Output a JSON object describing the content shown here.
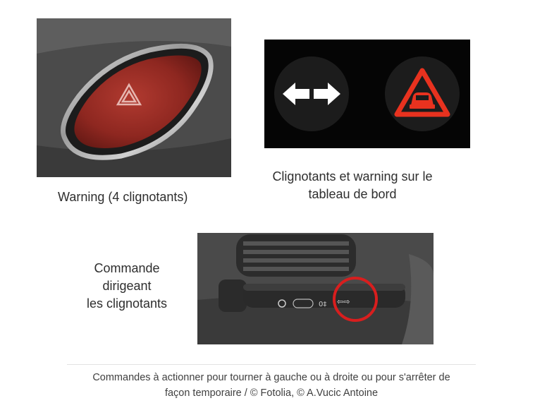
{
  "images": {
    "hazard_button": {
      "icon": "hazard-triangle-icon",
      "accent": "#9a2a22"
    },
    "dashboard": {
      "icons": [
        "turn-signal-arrows-icon",
        "hazard-car-triangle-icon"
      ],
      "arrow_color": "#ffffff",
      "warning_color": "#e8321f"
    },
    "stalk": {
      "highlight_color": "#d81e1e"
    }
  },
  "captions": {
    "warning": "Warning (4 clignotants)",
    "dashboard_line1": "Clignotants et warning sur le",
    "dashboard_line2": "tableau de bord",
    "command_line1": "Commande",
    "command_line2": "dirigeant",
    "command_line3": "les clignotants"
  },
  "figure_caption": {
    "line1": "Commandes à actionner pour tourner à gauche ou à droite ou pour s'arrêter de",
    "line2": "façon temporaire / © Fotolia, © A.Vucic Antoine"
  }
}
